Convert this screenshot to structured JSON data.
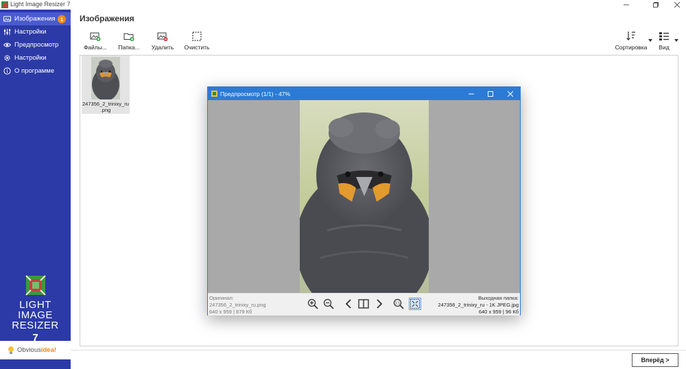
{
  "window": {
    "title": "Light Image Resizer 7"
  },
  "sidebar": {
    "items": [
      {
        "label": "Изображения",
        "icon": "images-icon",
        "active": true,
        "badge": "1"
      },
      {
        "label": "Настройки",
        "icon": "sliders-icon"
      },
      {
        "label": "Предпросмотр",
        "icon": "eye-icon"
      },
      {
        "label": "Настройки",
        "icon": "gear-icon"
      },
      {
        "label": "О программе",
        "icon": "info-icon"
      }
    ],
    "logo": {
      "line1": "LIGHT",
      "line2": "IMAGE",
      "line3": "RESIZER",
      "version": "7"
    },
    "brand": {
      "part1": "Obvious",
      "part2": "idea!"
    }
  },
  "main": {
    "title": "Изображения",
    "toolbar": {
      "files": "Файлы...",
      "folder": "Папка...",
      "delete": "Удалить",
      "clear": "Очистить",
      "sort": "Сортировка",
      "view": "Вид"
    },
    "thumbnails": [
      {
        "caption_line1": "247356_2_trinixy_ru",
        "caption_line2": ".png"
      }
    ],
    "next_button": "Вперёд >"
  },
  "preview": {
    "title": "Предпросмотр (1/1) - 47%",
    "original_label": "Оригинал:",
    "original_file": "247356_2_trinixy_ru.png",
    "original_info": "640 x 959 | 879 Кб",
    "output_label": "Выходная папка:",
    "output_file": "247356_2_trinixy_ru - 1K JPEG.jpg",
    "output_info": "640 x 959 | 96 Кб"
  },
  "colors": {
    "sidebar": "#2b3aa6",
    "sidebar_active": "#4a5bd0",
    "accent": "#2b7bd6",
    "badge": "#f28a1e"
  }
}
